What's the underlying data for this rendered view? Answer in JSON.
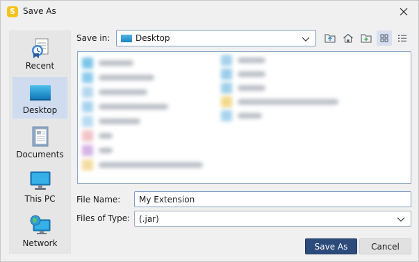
{
  "window": {
    "title": "Save As",
    "app_icon_letter": "S",
    "accent_color": "#2c4a7a"
  },
  "sidebar": {
    "items": [
      {
        "label": "Recent",
        "icon": "recent-icon",
        "selected": false
      },
      {
        "label": "Desktop",
        "icon": "desktop-icon",
        "selected": true
      },
      {
        "label": "Documents",
        "icon": "documents-icon",
        "selected": false
      },
      {
        "label": "This PC",
        "icon": "computer-icon",
        "selected": false
      },
      {
        "label": "Network",
        "icon": "network-icon",
        "selected": false
      }
    ]
  },
  "save_in": {
    "label": "Save in:",
    "value": "Desktop"
  },
  "toolbar": {
    "buttons": [
      {
        "icon": "up-folder-icon"
      },
      {
        "icon": "home-icon"
      },
      {
        "icon": "new-folder-icon"
      },
      {
        "icon": "list-view-icon",
        "active": true
      },
      {
        "icon": "details-view-icon"
      }
    ]
  },
  "file_name": {
    "label": "File Name:",
    "value": "My Extension"
  },
  "file_type": {
    "label": "Files of Type:",
    "value": "(.jar)"
  },
  "buttons": {
    "save": "Save As",
    "cancel": "Cancel"
  }
}
